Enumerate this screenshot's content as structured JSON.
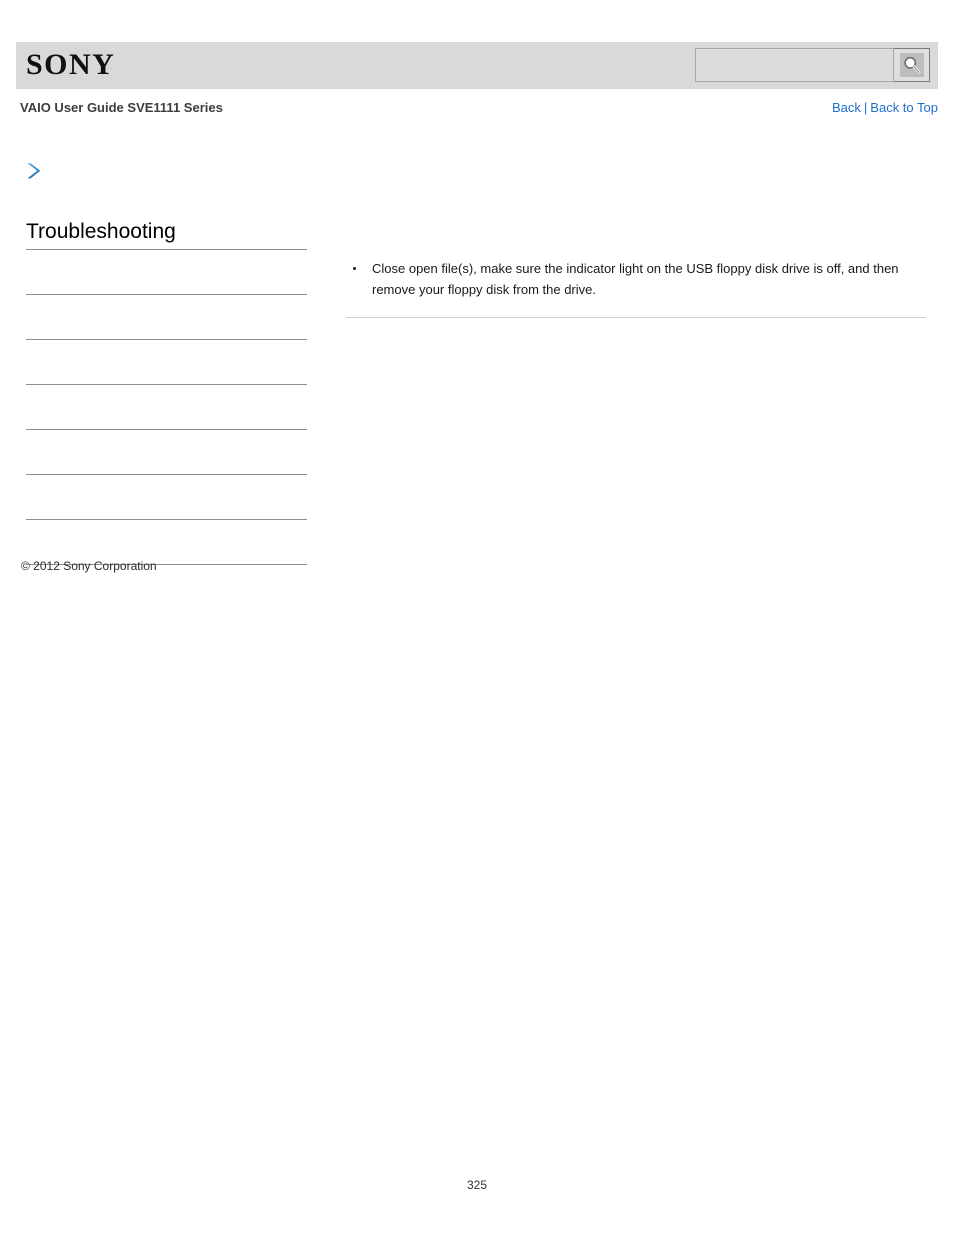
{
  "header": {
    "logo_text": "SONY",
    "search": {
      "value": "",
      "placeholder": "",
      "button_icon": "search-icon"
    }
  },
  "subheader": {
    "guide_title": "VAIO User Guide SVE1111 Series",
    "links": [
      {
        "label": "Back"
      },
      {
        "label": "Back to Top"
      }
    ],
    "separator": "|"
  },
  "breadcrumb": {
    "arrow_icon": "chevron-right-icon",
    "label": ""
  },
  "sidebar": {
    "heading": "Troubleshooting",
    "items": [
      {
        "label": ""
      },
      {
        "label": ""
      },
      {
        "label": ""
      },
      {
        "label": ""
      },
      {
        "label": ""
      },
      {
        "label": ""
      },
      {
        "label": ""
      }
    ]
  },
  "main": {
    "answers": [
      "Close open file(s), make sure the indicator light on the USB floppy disk drive is off, and then remove your floppy disk from the drive."
    ]
  },
  "footer": {
    "copyright": "© 2012 Sony Corporation",
    "page_number": "325"
  },
  "colors": {
    "header_background": "#d9d9d9",
    "link": "#1f6fcc",
    "accent_arrow": "#2e8bc8",
    "rule": "#8c8c8c",
    "content_rule": "#cfcfcf"
  }
}
